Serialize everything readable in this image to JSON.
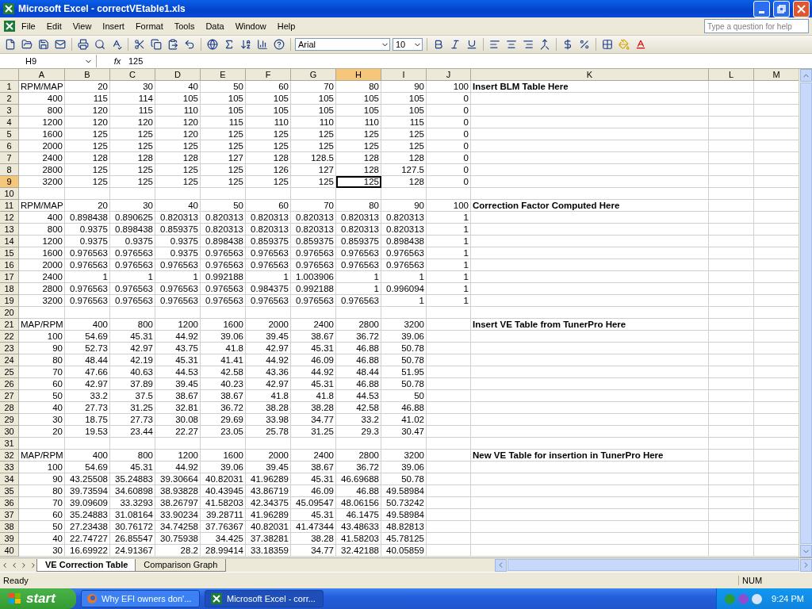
{
  "window": {
    "title": "Microsoft Excel - correctVEtable1.xls"
  },
  "menu": [
    "File",
    "Edit",
    "View",
    "Insert",
    "Format",
    "Tools",
    "Data",
    "Window",
    "Help"
  ],
  "help_box": {
    "placeholder": "Type a question for help"
  },
  "font_box": {
    "font": "Arial",
    "size": "10"
  },
  "formula_bar": {
    "name_box": "H9",
    "fx": "fx",
    "value": "125"
  },
  "columns": [
    {
      "label": "A",
      "selected": false
    },
    {
      "label": "B",
      "selected": false
    },
    {
      "label": "C",
      "selected": false
    },
    {
      "label": "D",
      "selected": false
    },
    {
      "label": "E",
      "selected": false
    },
    {
      "label": "F",
      "selected": false
    },
    {
      "label": "G",
      "selected": false
    },
    {
      "label": "H",
      "selected": true
    },
    {
      "label": "I",
      "selected": false
    },
    {
      "label": "J",
      "selected": false
    },
    {
      "label": "K",
      "selected": false
    },
    {
      "label": "L",
      "selected": false
    },
    {
      "label": "M",
      "selected": false
    }
  ],
  "rows": [
    {
      "number": "1",
      "kind": "header",
      "selected": false,
      "cells": [
        "RPM/MAP",
        "20",
        "30",
        "40",
        "50",
        "60",
        "70",
        "80",
        "90",
        "100"
      ],
      "note": "Insert BLM Table Here"
    },
    {
      "number": "2",
      "kind": "data",
      "selected": false,
      "cells": [
        "400",
        "115",
        "114",
        "105",
        "105",
        "105",
        "105",
        "105",
        "105",
        "0"
      ]
    },
    {
      "number": "3",
      "kind": "data",
      "selected": false,
      "cells": [
        "800",
        "120",
        "115",
        "110",
        "105",
        "105",
        "105",
        "105",
        "105",
        "0"
      ]
    },
    {
      "number": "4",
      "kind": "data",
      "selected": false,
      "cells": [
        "1200",
        "120",
        "120",
        "120",
        "115",
        "110",
        "110",
        "110",
        "115",
        "0"
      ]
    },
    {
      "number": "5",
      "kind": "data",
      "selected": false,
      "cells": [
        "1600",
        "125",
        "125",
        "120",
        "125",
        "125",
        "125",
        "125",
        "125",
        "0"
      ]
    },
    {
      "number": "6",
      "kind": "data",
      "selected": false,
      "cells": [
        "2000",
        "125",
        "125",
        "125",
        "125",
        "125",
        "125",
        "125",
        "125",
        "0"
      ]
    },
    {
      "number": "7",
      "kind": "data",
      "selected": false,
      "cells": [
        "2400",
        "128",
        "128",
        "128",
        "127",
        "128",
        "128.5",
        "128",
        "128",
        "0"
      ]
    },
    {
      "number": "8",
      "kind": "data",
      "selected": false,
      "cells": [
        "2800",
        "125",
        "125",
        "125",
        "125",
        "126",
        "127",
        "128",
        "127.5",
        "0"
      ]
    },
    {
      "number": "9",
      "kind": "data",
      "selected": true,
      "cells": [
        "3200",
        "125",
        "125",
        "125",
        "125",
        "125",
        "125",
        "125",
        "128",
        "0"
      ]
    },
    {
      "number": "10",
      "selected": false
    },
    {
      "number": "11",
      "kind": "header",
      "selected": false,
      "cells": [
        "RPM/MAP",
        "20",
        "30",
        "40",
        "50",
        "60",
        "70",
        "80",
        "90",
        "100"
      ],
      "note": "Correction Factor Computed Here"
    },
    {
      "number": "12",
      "kind": "data",
      "selected": false,
      "cells": [
        "400",
        "0.898438",
        "0.890625",
        "0.820313",
        "0.820313",
        "0.820313",
        "0.820313",
        "0.820313",
        "0.820313",
        "1"
      ]
    },
    {
      "number": "13",
      "kind": "data",
      "selected": false,
      "cells": [
        "800",
        "0.9375",
        "0.898438",
        "0.859375",
        "0.820313",
        "0.820313",
        "0.820313",
        "0.820313",
        "0.820313",
        "1"
      ]
    },
    {
      "number": "14",
      "kind": "data",
      "selected": false,
      "cells": [
        "1200",
        "0.9375",
        "0.9375",
        "0.9375",
        "0.898438",
        "0.859375",
        "0.859375",
        "0.859375",
        "0.898438",
        "1"
      ]
    },
    {
      "number": "15",
      "kind": "data",
      "selected": false,
      "cells": [
        "1600",
        "0.976563",
        "0.976563",
        "0.9375",
        "0.976563",
        "0.976563",
        "0.976563",
        "0.976563",
        "0.976563",
        "1"
      ]
    },
    {
      "number": "16",
      "kind": "data",
      "selected": false,
      "cells": [
        "2000",
        "0.976563",
        "0.976563",
        "0.976563",
        "0.976563",
        "0.976563",
        "0.976563",
        "0.976563",
        "0.976563",
        "1"
      ]
    },
    {
      "number": "17",
      "kind": "data",
      "selected": false,
      "cells": [
        "2400",
        "1",
        "1",
        "1",
        "0.992188",
        "1",
        "1.003906",
        "1",
        "1",
        "1"
      ]
    },
    {
      "number": "18",
      "kind": "data",
      "selected": false,
      "cells": [
        "2800",
        "0.976563",
        "0.976563",
        "0.976563",
        "0.976563",
        "0.984375",
        "0.992188",
        "1",
        "0.996094",
        "1"
      ]
    },
    {
      "number": "19",
      "kind": "data",
      "selected": false,
      "cells": [
        "3200",
        "0.976563",
        "0.976563",
        "0.976563",
        "0.976563",
        "0.976563",
        "0.976563",
        "0.976563",
        "1",
        "1"
      ]
    },
    {
      "number": "20",
      "selected": false
    },
    {
      "number": "21",
      "kind": "header",
      "selected": false,
      "cells": [
        "MAP/RPM",
        "400",
        "800",
        "1200",
        "1600",
        "2000",
        "2400",
        "2800",
        "3200"
      ],
      "note": "Insert VE Table from TunerPro Here"
    },
    {
      "number": "22",
      "kind": "data",
      "selected": false,
      "cells": [
        "100",
        "54.69",
        "45.31",
        "44.92",
        "39.06",
        "39.45",
        "38.67",
        "36.72",
        "39.06"
      ]
    },
    {
      "number": "23",
      "kind": "data",
      "selected": false,
      "cells": [
        "90",
        "52.73",
        "42.97",
        "43.75",
        "41.8",
        "42.97",
        "45.31",
        "46.88",
        "50.78"
      ]
    },
    {
      "number": "24",
      "kind": "data",
      "selected": false,
      "cells": [
        "80",
        "48.44",
        "42.19",
        "45.31",
        "41.41",
        "44.92",
        "46.09",
        "46.88",
        "50.78"
      ]
    },
    {
      "number": "25",
      "kind": "data",
      "selected": false,
      "cells": [
        "70",
        "47.66",
        "40.63",
        "44.53",
        "42.58",
        "43.36",
        "44.92",
        "48.44",
        "51.95"
      ]
    },
    {
      "number": "26",
      "kind": "data",
      "selected": false,
      "cells": [
        "60",
        "42.97",
        "37.89",
        "39.45",
        "40.23",
        "42.97",
        "45.31",
        "46.88",
        "50.78"
      ]
    },
    {
      "number": "27",
      "kind": "data",
      "selected": false,
      "cells": [
        "50",
        "33.2",
        "37.5",
        "38.67",
        "38.67",
        "41.8",
        "41.8",
        "44.53",
        "50"
      ]
    },
    {
      "number": "28",
      "kind": "data",
      "selected": false,
      "cells": [
        "40",
        "27.73",
        "31.25",
        "32.81",
        "36.72",
        "38.28",
        "38.28",
        "42.58",
        "46.88"
      ]
    },
    {
      "number": "29",
      "kind": "data",
      "selected": false,
      "cells": [
        "30",
        "18.75",
        "27.73",
        "30.08",
        "29.69",
        "33.98",
        "34.77",
        "33.2",
        "41.02"
      ]
    },
    {
      "number": "30",
      "kind": "data",
      "selected": false,
      "cells": [
        "20",
        "19.53",
        "23.44",
        "22.27",
        "23.05",
        "25.78",
        "31.25",
        "29.3",
        "30.47"
      ]
    },
    {
      "number": "31",
      "selected": false
    },
    {
      "number": "32",
      "kind": "header",
      "selected": false,
      "cells": [
        "MAP/RPM",
        "400",
        "800",
        "1200",
        "1600",
        "2000",
        "2400",
        "2800",
        "3200"
      ],
      "note": "New VE Table for insertion in TunerPro Here"
    },
    {
      "number": "33",
      "kind": "data",
      "selected": false,
      "cells": [
        "100",
        "54.69",
        "45.31",
        "44.92",
        "39.06",
        "39.45",
        "38.67",
        "36.72",
        "39.06"
      ]
    },
    {
      "number": "34",
      "kind": "data",
      "selected": false,
      "cells": [
        "90",
        "43.25508",
        "35.24883",
        "39.30664",
        "40.82031",
        "41.96289",
        "45.31",
        "46.69688",
        "50.78"
      ]
    },
    {
      "number": "35",
      "kind": "data",
      "selected": false,
      "cells": [
        "80",
        "39.73594",
        "34.60898",
        "38.93828",
        "40.43945",
        "43.86719",
        "46.09",
        "46.88",
        "49.58984"
      ]
    },
    {
      "number": "36",
      "kind": "data",
      "selected": false,
      "cells": [
        "70",
        "39.09609",
        "33.3293",
        "38.26797",
        "41.58203",
        "42.34375",
        "45.09547",
        "48.06156",
        "50.73242"
      ]
    },
    {
      "number": "37",
      "kind": "data",
      "selected": false,
      "cells": [
        "60",
        "35.24883",
        "31.08164",
        "33.90234",
        "39.28711",
        "41.96289",
        "45.31",
        "46.1475",
        "49.58984"
      ]
    },
    {
      "number": "38",
      "kind": "data",
      "selected": false,
      "cells": [
        "50",
        "27.23438",
        "30.76172",
        "34.74258",
        "37.76367",
        "40.82031",
        "41.47344",
        "43.48633",
        "48.82813"
      ]
    },
    {
      "number": "39",
      "kind": "data",
      "selected": false,
      "cells": [
        "40",
        "22.74727",
        "26.85547",
        "30.75938",
        "34.425",
        "37.38281",
        "38.28",
        "41.58203",
        "45.78125"
      ]
    },
    {
      "number": "40",
      "kind": "data",
      "selected": false,
      "cells": [
        "30",
        "16.69922",
        "24.91367",
        "28.2",
        "28.99414",
        "33.18359",
        "34.77",
        "32.42188",
        "40.05859"
      ]
    }
  ],
  "sheet_tabs": [
    {
      "label": "VE Correction Table",
      "selected": true
    },
    {
      "label": "Comparison Graph",
      "selected": false
    }
  ],
  "status_bar": {
    "status": "Ready",
    "num": "NUM"
  },
  "taskbar": {
    "start": "start",
    "tasks": [
      {
        "label": "Why EFI owners don'...",
        "kind": "browser",
        "selected": false
      },
      {
        "label": "Microsoft Excel - corr...",
        "kind": "excel",
        "selected": true
      }
    ],
    "clock": "9:24 PM"
  }
}
